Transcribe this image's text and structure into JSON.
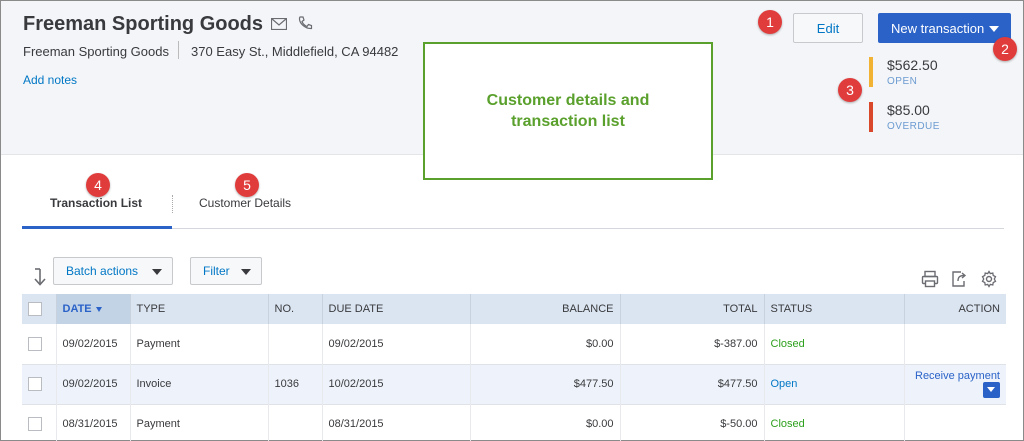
{
  "customer": {
    "name": "Freeman Sporting Goods",
    "company": "Freeman Sporting Goods",
    "address": "370 Easy St., Middlefield, CA 94482",
    "add_notes_label": "Add notes"
  },
  "actions": {
    "edit_label": "Edit",
    "new_transaction_label": "New transaction"
  },
  "balances": {
    "open": {
      "amount": "$562.50",
      "label": "OPEN",
      "color": "#f2b233"
    },
    "overdue": {
      "amount": "$85.00",
      "label": "OVERDUE",
      "color": "#d9482b"
    }
  },
  "annotation": {
    "text": "Customer details and transaction list",
    "color": "#5aa02c"
  },
  "callouts": [
    "1",
    "2",
    "3",
    "4",
    "5"
  ],
  "tabs": [
    {
      "label": "Transaction List",
      "active": true
    },
    {
      "label": "Customer Details",
      "active": false
    }
  ],
  "toolbar": {
    "batch_actions_label": "Batch actions",
    "filter_label": "Filter",
    "icons": [
      "sort-icon",
      "print-icon",
      "export-icon",
      "settings-icon"
    ]
  },
  "table": {
    "headers": {
      "date": "DATE",
      "type": "TYPE",
      "no": "NO.",
      "due_date": "DUE DATE",
      "balance": "BALANCE",
      "total": "TOTAL",
      "status": "STATUS",
      "action": "ACTION"
    },
    "rows": [
      {
        "date": "09/02/2015",
        "type": "Payment",
        "no": "",
        "due_date": "09/02/2015",
        "balance": "$0.00",
        "total": "$-387.00",
        "status": "Closed",
        "action": ""
      },
      {
        "date": "09/02/2015",
        "type": "Invoice",
        "no": "1036",
        "due_date": "10/02/2015",
        "balance": "$477.50",
        "total": "$477.50",
        "status": "Open",
        "action": "Receive payment"
      },
      {
        "date": "08/31/2015",
        "type": "Payment",
        "no": "",
        "due_date": "08/31/2015",
        "balance": "$0.00",
        "total": "$-50.00",
        "status": "Closed",
        "action": ""
      }
    ]
  },
  "colors": {
    "accent": "#2a62c8",
    "link": "#0077c5",
    "closed": "#2ca01c",
    "callout": "#e03c3c"
  }
}
